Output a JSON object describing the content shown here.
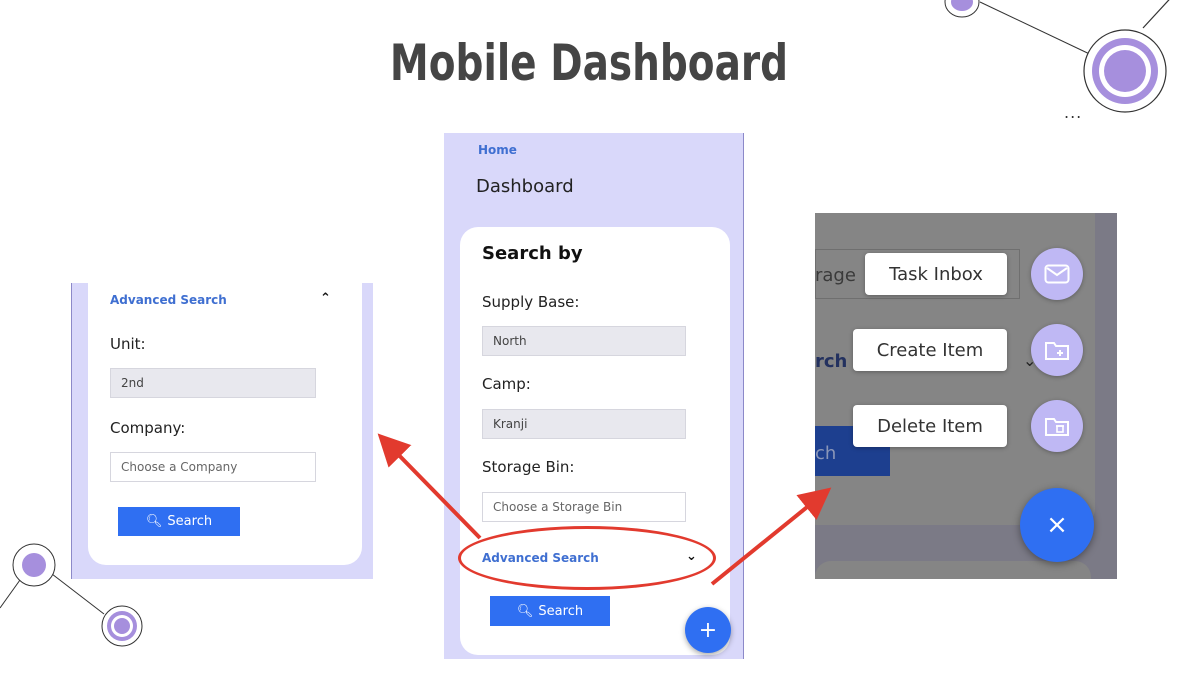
{
  "title": "Mobile Dashboard",
  "phone": {
    "breadcrumb": "Home",
    "page_title": "Dashboard",
    "search_title": "Search by",
    "supply_base_label": "Supply Base:",
    "supply_base_value": "North",
    "camp_label": "Camp:",
    "camp_value": "Kranji",
    "storage_bin_label": "Storage Bin:",
    "storage_bin_placeholder": "Choose a Storage Bin",
    "advanced_search_label": "Advanced Search",
    "search_button_label": "Search",
    "fab_plus_glyph": "+"
  },
  "left_panel": {
    "advanced_search_label": "Advanced Search",
    "unit_label": "Unit:",
    "unit_value": "2nd",
    "company_label": "Company:",
    "company_placeholder": "Choose a Company",
    "search_button_label": "Search"
  },
  "right_panel": {
    "background_text_1": "rage",
    "background_text_2": "rch",
    "background_text_3": "ch",
    "menu_items": [
      {
        "label": "Task Inbox",
        "icon": "mail-icon"
      },
      {
        "label": "Create Item",
        "icon": "folder-plus-icon"
      },
      {
        "label": "Delete Item",
        "icon": "folder-delete-icon"
      }
    ],
    "close_glyph": "×"
  },
  "colors": {
    "accent": "#2f6ff2",
    "panel_bg": "#d9d8fa",
    "link": "#3f6fd1",
    "annotation_red": "#e23a2e",
    "deco_purple": "#a68fdd"
  },
  "decoration": {
    "ellipsis": "..."
  }
}
